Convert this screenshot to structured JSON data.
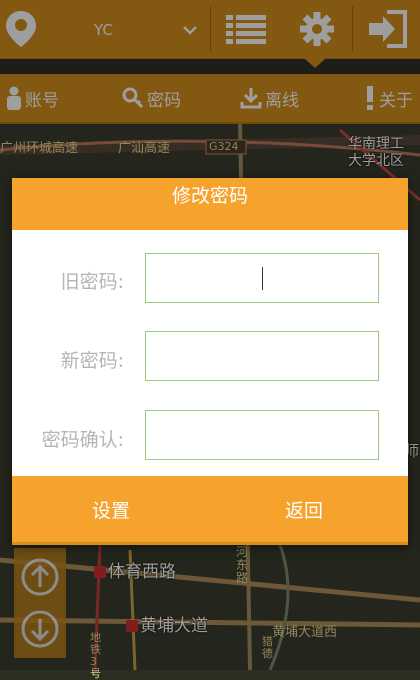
{
  "colors": {
    "accent": "#f6a32e",
    "bar": "#d48f1c",
    "field_border": "#9ccc7a",
    "label": "#b5b5b5"
  },
  "header": {
    "vehicle_value": "YC",
    "icons": [
      "location-pin-icon",
      "list-icon",
      "gear-icon",
      "logout-icon"
    ]
  },
  "subnav": {
    "items": [
      {
        "label": "账号",
        "icon": "person-icon"
      },
      {
        "label": "密码",
        "icon": "key-icon"
      },
      {
        "label": "离线",
        "icon": "download-icon"
      },
      {
        "label": "关于",
        "icon": "exclamation-icon"
      }
    ]
  },
  "map": {
    "labels": {
      "ring_road": "广州环城高速",
      "guangshan": "广汕高速",
      "g324": "G324",
      "scut": "华南理工\n大学北区",
      "stadium": "体育西路",
      "huangpu": "黄埔大道",
      "huangpu_w": "黄埔大道西",
      "metro": "地\n铁\n3\n号",
      "river": "猎\n德",
      "hedong": "河\n东\n路",
      "shi": "师"
    }
  },
  "dialog": {
    "title": "修改密码",
    "old_label": "旧密码:",
    "new_label": "新密码:",
    "confirm_label": "密码确认:",
    "old_value": "",
    "new_value": "",
    "confirm_value": "",
    "set_label": "设置",
    "back_label": "返回"
  }
}
